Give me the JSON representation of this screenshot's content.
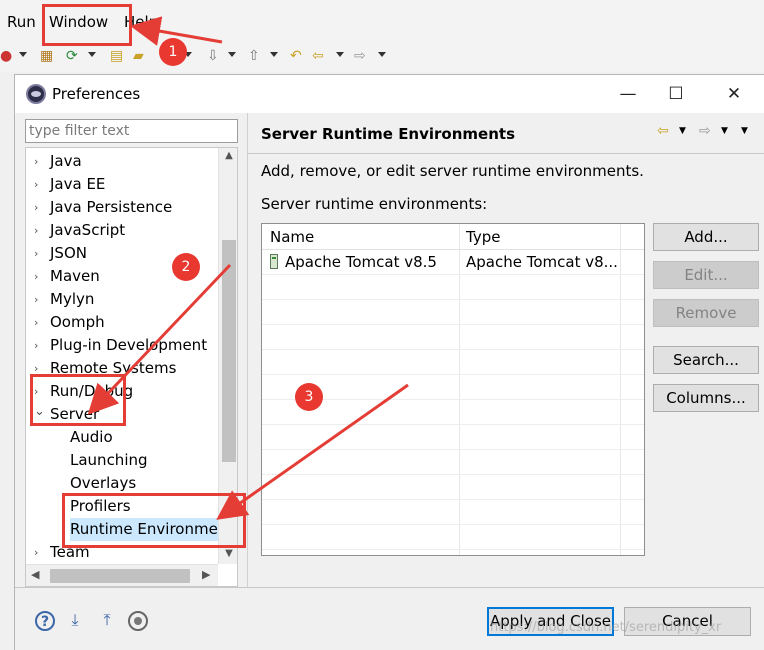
{
  "menubar": {
    "items": [
      "Run",
      "Window",
      "Help"
    ]
  },
  "dialog": {
    "title": "Preferences",
    "window_controls": {
      "minimize": "—",
      "maximize": "☐",
      "close": "✕"
    },
    "filter": {
      "value": "",
      "placeholder": "type filter text"
    },
    "tree": {
      "items": [
        {
          "label": "Java",
          "arrow": "›"
        },
        {
          "label": "Java EE",
          "arrow": "›"
        },
        {
          "label": "Java Persistence",
          "arrow": "›"
        },
        {
          "label": "JavaScript",
          "arrow": "›"
        },
        {
          "label": "JSON",
          "arrow": "›"
        },
        {
          "label": "Maven",
          "arrow": "›"
        },
        {
          "label": "Mylyn",
          "arrow": "›"
        },
        {
          "label": "Oomph",
          "arrow": "›"
        },
        {
          "label": "Plug-in Development",
          "arrow": "›"
        },
        {
          "label": "Remote Systems",
          "arrow": "›"
        },
        {
          "label": "Run/Debug",
          "arrow": "›"
        },
        {
          "label": "Server",
          "arrow": "⌄"
        },
        {
          "label": "Audio"
        },
        {
          "label": "Launching"
        },
        {
          "label": "Overlays"
        },
        {
          "label": "Profilers"
        },
        {
          "label": "Runtime Environmer"
        },
        {
          "label": "Team",
          "arrow": "›"
        }
      ]
    },
    "panel": {
      "title": "Server Runtime Environments",
      "description": "Add, remove, or edit server runtime environments.",
      "list_label": "Server runtime environments:",
      "table": {
        "columns": [
          "Name",
          "Type"
        ],
        "rows": [
          {
            "name": "Apache Tomcat v8.5",
            "type": "Apache Tomcat v8..."
          }
        ]
      },
      "buttons": {
        "add": "Add...",
        "edit": "Edit...",
        "remove": "Remove",
        "search": "Search...",
        "columns": "Columns..."
      }
    },
    "footer": {
      "apply_close": "Apply and Close",
      "cancel": "Cancel",
      "watermark": "https://blog.csdn.net/serendipity_xr"
    }
  },
  "annotations": {
    "badges": [
      "1",
      "2",
      "3"
    ],
    "color": "#e43d36"
  }
}
